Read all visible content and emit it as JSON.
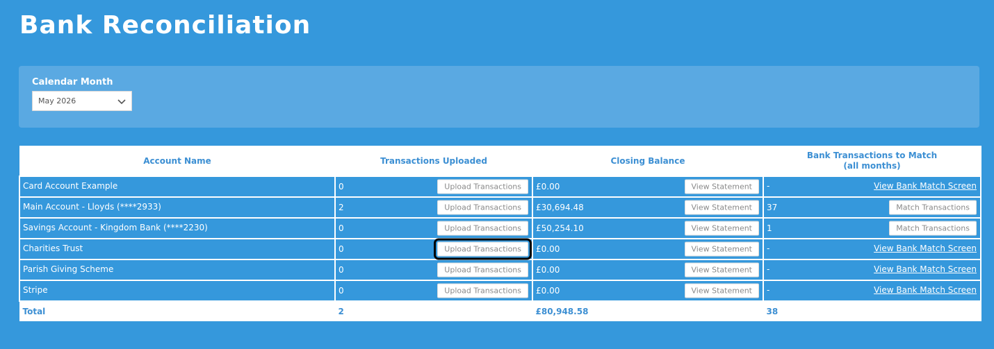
{
  "page": {
    "title": "Bank Reconciliation"
  },
  "filter": {
    "label": "Calendar Month",
    "selected": "May 2026",
    "icon": "chevron-down-icon"
  },
  "table": {
    "headers": {
      "account_name": "Account Name",
      "transactions_uploaded": "Transactions Uploaded",
      "closing_balance": "Closing Balance",
      "to_match_line1": "Bank Transactions to Match",
      "to_match_line2": "(all months)"
    },
    "rows": [
      {
        "account": "Card Account Example",
        "uploaded": "0",
        "upload_btn": "Upload Transactions",
        "balance": "£0.00",
        "statement_btn": "View Statement",
        "to_match": "-",
        "action": "View Bank Match Screen"
      },
      {
        "account": "Main Account - Lloyds (****2933)",
        "uploaded": "2",
        "upload_btn": "Upload Transactions",
        "balance": "£30,694.48",
        "statement_btn": "View Statement",
        "to_match": "37",
        "action": "Match Transactions"
      },
      {
        "account": "Savings Account - Kingdom Bank (****2230)",
        "uploaded": "0",
        "upload_btn": "Upload Transactions",
        "balance": "£50,254.10",
        "statement_btn": "View Statement",
        "to_match": "1",
        "action": "Match Transactions"
      },
      {
        "account": "Charities Trust",
        "uploaded": "0",
        "upload_btn": "Upload Transactions",
        "balance": "£0.00",
        "statement_btn": "View Statement",
        "to_match": "-",
        "action": "View Bank Match Screen"
      },
      {
        "account": "Parish Giving Scheme",
        "uploaded": "0",
        "upload_btn": "Upload Transactions",
        "balance": "£0.00",
        "statement_btn": "View Statement",
        "to_match": "-",
        "action": "View Bank Match Screen"
      },
      {
        "account": "Stripe",
        "uploaded": "0",
        "upload_btn": "Upload Transactions",
        "balance": "£0.00",
        "statement_btn": "View Statement",
        "to_match": "-",
        "action": "View Bank Match Screen"
      }
    ],
    "total": {
      "label": "Total",
      "uploaded": "2",
      "balance": "£80,948.58",
      "to_match": "38"
    }
  },
  "colors": {
    "background": "#3598dc",
    "panel": "#5aa9e2",
    "header_text": "#3c8fd3"
  }
}
